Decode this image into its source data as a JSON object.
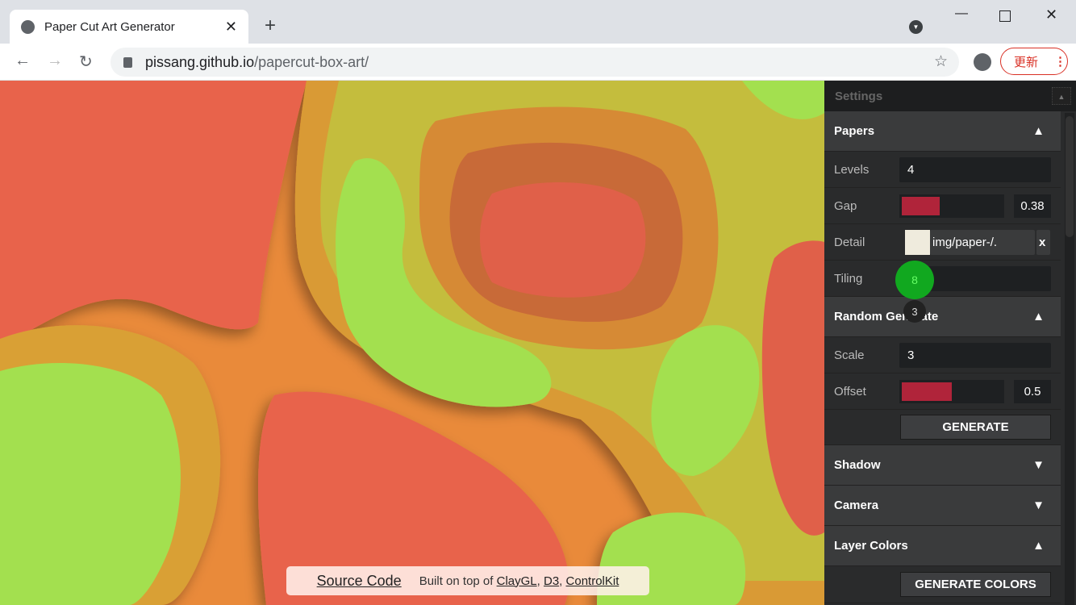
{
  "browser": {
    "tab_title": "Paper Cut Art Generator",
    "url_host": "pissang.github.io",
    "url_path": "/papercut-box-art/",
    "update_label": "更新"
  },
  "footer": {
    "source_code": "Source Code",
    "built_on": "Built on top of",
    "links": [
      "ClayGL",
      "D3",
      "ControlKit"
    ]
  },
  "settings": {
    "title": "Settings",
    "papers": {
      "title": "Papers",
      "levels_label": "Levels",
      "levels": "4",
      "gap_label": "Gap",
      "gap": "0.38",
      "gap_fraction": 0.38,
      "detail_label": "Detail",
      "detail_value": "img/paper-/.",
      "detail_clear": "x",
      "detail_color": "#efebdd",
      "tiling_label": "Tiling",
      "tiling": "8"
    },
    "random": {
      "title": "Random Generate",
      "scale_label": "Scale",
      "scale": "3",
      "offset_label": "Offset",
      "offset": "0.5",
      "offset_fraction": 0.5,
      "generate": "GENERATE"
    },
    "shadow": "Shadow",
    "camera": "Camera",
    "layer_colors": "Layer Colors",
    "generate_colors": "GENERATE COLORS"
  },
  "touch_indicator": "3",
  "colors": {
    "accent": "#b0243a",
    "red": "#e8644c",
    "orange": "#e98a3a",
    "olive": "#c4bd3e",
    "green": "#a3e050"
  }
}
